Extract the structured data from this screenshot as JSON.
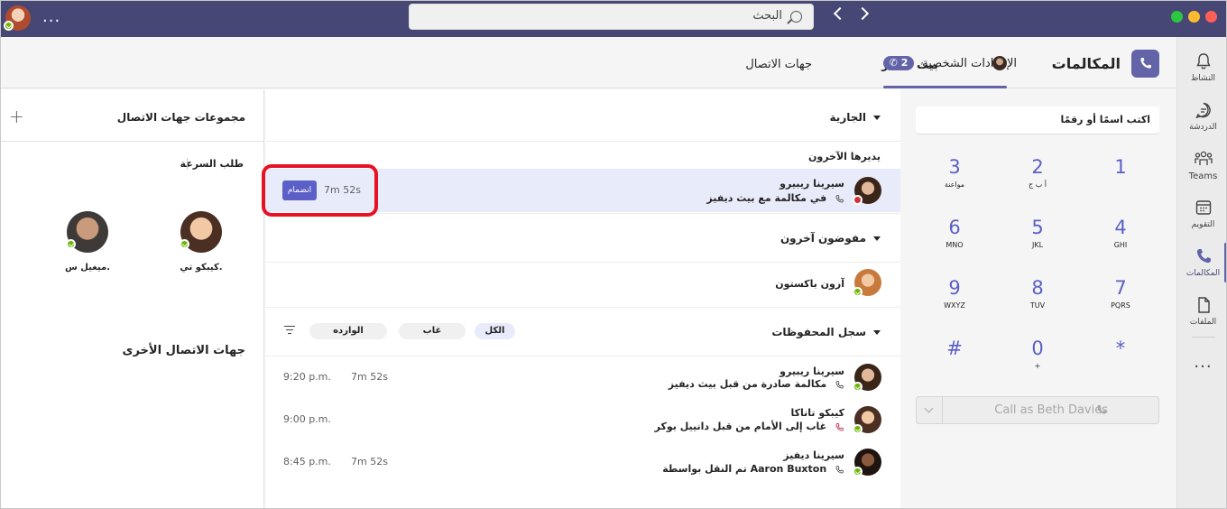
{
  "titlebar": {
    "search_text": "البحث",
    "more": "...",
    "window_dots": [
      "#2bc840",
      "#febc2e",
      "#fe5f57"
    ]
  },
  "header": {
    "title": "المكالمات",
    "settings": "الإعدادات الشخصية",
    "user": "بيث ديفيز",
    "counter": "2",
    "contacts_tab": "جهات الاتصال"
  },
  "rail": {
    "items": [
      {
        "label": "النشاط",
        "icon": "bell-icon"
      },
      {
        "label": "الدردشة",
        "icon": "chat-icon"
      },
      {
        "label": "Teams",
        "icon": "teams-icon"
      },
      {
        "label": "التقويم",
        "icon": "calendar-icon"
      },
      {
        "label": "المكالمات",
        "icon": "phone-icon"
      },
      {
        "label": "الملفات",
        "icon": "files-icon"
      }
    ],
    "more": "..."
  },
  "dialpad": {
    "placeholder": "اكتب اسمًا أو رقمًا",
    "keys": [
      {
        "n": "1",
        "s": ""
      },
      {
        "n": "2",
        "s": "أ ب ج"
      },
      {
        "n": "3",
        "s": "مواعنة"
      },
      {
        "n": "4",
        "s": "GHI"
      },
      {
        "n": "5",
        "s": "JKL"
      },
      {
        "n": "6",
        "s": "MNO"
      },
      {
        "n": "7",
        "s": "PQRS"
      },
      {
        "n": "8",
        "s": "TUV"
      },
      {
        "n": "9",
        "s": "WXYZ"
      },
      {
        "n": "*",
        "s": ""
      },
      {
        "n": "0",
        "s": "+"
      },
      {
        "n": "#",
        "s": ""
      }
    ],
    "call_label": "Call as Beth Davies"
  },
  "history": {
    "ongoing": "الجارية",
    "managed_by_others": "يديرها الآخرون",
    "live": {
      "name": "سيرينا ريبيرو",
      "sub": "في مكالمة مع بيث ديفيز",
      "duration": "7m 52s",
      "join": "انضمام"
    },
    "delegates": "مفوضون آخرون",
    "delegate_person": "آرون باكستون",
    "saved_log": "سجل المحفوظات",
    "chips": [
      "الكل",
      "غاب",
      "الوارده"
    ],
    "rows": [
      {
        "name": "سيرينا ريبيرو",
        "sub": "مكالمة صادرة من قبل بيث ديفيز",
        "duration": "7m 52s",
        "time": "9:20 p.m."
      },
      {
        "name": "كيبكو تاناكا",
        "sub": "غاب إلى الأمام من قبل دانييل بوكر",
        "duration": "",
        "time": "9:00 p.m."
      },
      {
        "name": "سيرينا ديفيز",
        "sub": "تم النقل بواسطة Aaron Buxton",
        "duration": "7m 52s",
        "time": "8:45 p.m."
      }
    ]
  },
  "contacts": {
    "groups_title": "مجموعات جهات الاتصال",
    "speed_dial": "طلب السرعة",
    "people": [
      {
        "name": "كيبكو تي."
      },
      {
        "name": "ميغيل س."
      }
    ],
    "other_contacts": "جهات الاتصال الأخرى"
  }
}
